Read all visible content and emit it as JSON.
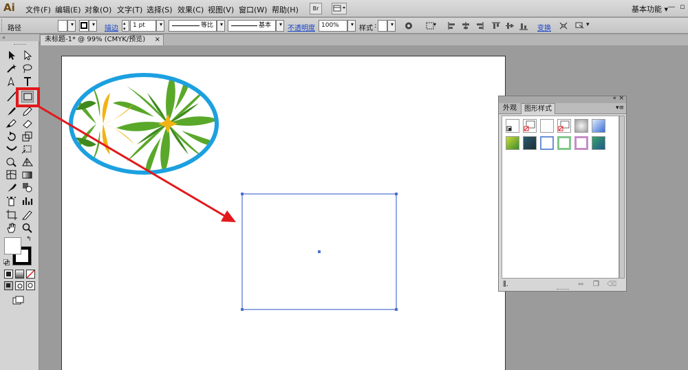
{
  "app": {
    "logo": "Ai"
  },
  "menu": {
    "items": [
      "文件(F)",
      "编辑(E)",
      "对象(O)",
      "文字(T)",
      "选择(S)",
      "效果(C)",
      "视图(V)",
      "窗口(W)",
      "帮助(H)"
    ],
    "bridge_button": "Br",
    "workspace_label": "基本功能",
    "workspace_arrow": "▾"
  },
  "control": {
    "selection_label": "路径",
    "stroke_link": "描边",
    "stroke_weight": "1 pt",
    "stroke_profile": "等比",
    "brush_def": "基本",
    "opacity_link": "不透明度",
    "opacity_value": "100%",
    "style_label": "样式",
    "transform_link": "变换"
  },
  "document": {
    "tab_title": "未标题-1* @ 99% (CMYK/预览)",
    "tab_close": "×"
  },
  "panel": {
    "tabs": [
      "外观",
      "图形样式"
    ],
    "active_tab": "图形样式",
    "menu_icon": "panel-menu-icon"
  },
  "colors": {
    "accent_red": "#e2181b",
    "selection_blue": "#4a6fd0",
    "oval_stroke": "#1ca0e0",
    "leaf_green": "#5aa82a",
    "leaf_yellow": "#f2b312"
  }
}
